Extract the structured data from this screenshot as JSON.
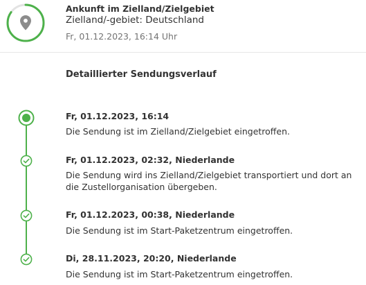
{
  "status": {
    "title": "Ankunft im Zielland/Zielgebiet",
    "subtitle": "Zielland/-gebiet: Deutschland",
    "timestamp": "Fr, 01.12.2023, 16:14 Uhr",
    "icon": "location-pin-icon",
    "ring_color": "#4db14a",
    "progress": 0.85
  },
  "history": {
    "heading": "Detaillierter Sendungsverlauf",
    "accent_color": "#4db14a",
    "events": [
      {
        "title": "Fr, 01.12.2023, 16:14",
        "description": "Die Sendung ist im Zielland/Zielgebiet eingetroffen.",
        "state": "current"
      },
      {
        "title": "Fr, 01.12.2023, 02:32, Niederlande",
        "description": "Die Sendung wird ins Zielland/Zielgebiet transportiert und dort an die Zustellorganisation übergeben.",
        "state": "done"
      },
      {
        "title": "Fr, 01.12.2023, 00:38, Niederlande",
        "description": "Die Sendung ist im Start-Paketzentrum eingetroffen.",
        "state": "done"
      },
      {
        "title": "Di, 28.11.2023, 20:20, Niederlande",
        "description": "Die Sendung ist im Start-Paketzentrum eingetroffen.",
        "state": "done"
      }
    ]
  }
}
